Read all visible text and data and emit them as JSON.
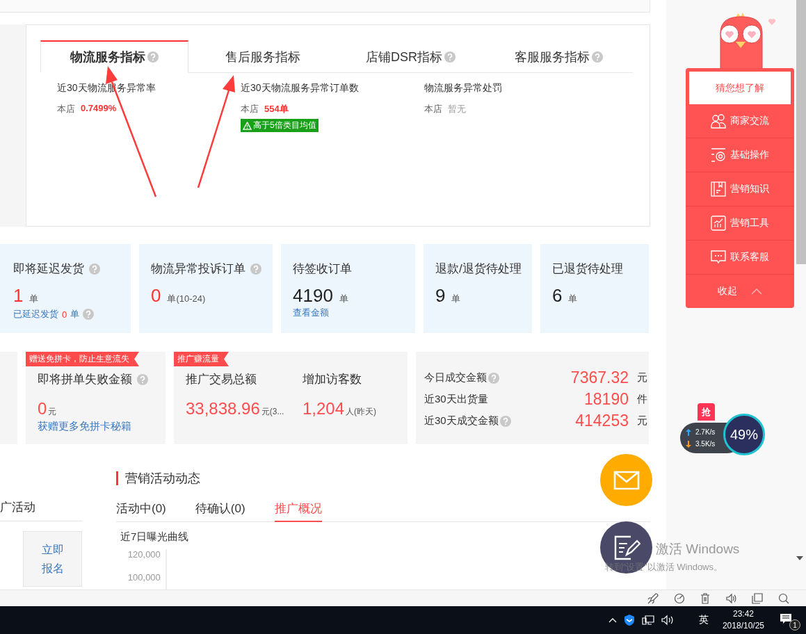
{
  "metric_tabs": [
    {
      "label": "物流服务指标",
      "help": true,
      "selected": true
    },
    {
      "label": "售后服务指标",
      "help": false,
      "selected": false
    },
    {
      "label": "店铺DSR指标",
      "help": true,
      "selected": false
    },
    {
      "label": "客服服务指标",
      "help": true,
      "selected": false
    }
  ],
  "metrics": [
    {
      "title": "近30天物流服务异常率",
      "store_label": "本店",
      "value": "0.7499%",
      "highlighted": true
    },
    {
      "title": "近30天物流服务异常订单数",
      "store_label": "本店",
      "value": "554单",
      "highlighted": true,
      "warning": "高于5倍类目均值"
    },
    {
      "title": "物流服务异常处罚",
      "store_label": "本店",
      "value": "暂无",
      "highlighted": false
    }
  ],
  "order_cards": [
    {
      "title": "即将延迟发货",
      "help": true,
      "count": "1",
      "alert": true,
      "unit": "单",
      "detail": {
        "label": "已延迟发货",
        "count": "0",
        "unit": "单",
        "help": true
      }
    },
    {
      "title": "物流异常投诉订单",
      "help": true,
      "count": "0",
      "alert": true,
      "unit": "单(10-24)"
    },
    {
      "title": "待签收订单",
      "help": false,
      "count": "4190",
      "alert": false,
      "unit": "单",
      "link": "查看金额"
    },
    {
      "title": "退款/退货待处理",
      "help": false,
      "count": "9",
      "alert": false,
      "unit": "单"
    },
    {
      "title": "已退货待处理",
      "help": false,
      "count": "6",
      "alert": false,
      "unit": "单"
    }
  ],
  "group_buy_card": {
    "ribbon": "赠送免拼卡，防止生意流失",
    "title": "即将拼单失败金额",
    "help": true,
    "value": "0",
    "unit": "元",
    "link": "获赠更多免拼卡秘籍"
  },
  "promo_card": {
    "ribbon": "推广赚流量",
    "stats": [
      {
        "label": "推广交易总额",
        "value": "33,838.96",
        "unit": "元(3..."
      },
      {
        "label": "增加访客数",
        "value": "1,204",
        "unit": "人(昨天)"
      }
    ]
  },
  "sales_card": {
    "rows": [
      {
        "label": "今日成交金额",
        "help": true,
        "value": "7367.32",
        "unit": "元"
      },
      {
        "label": "近30天出货量",
        "help": false,
        "value": "18190",
        "unit": "件"
      },
      {
        "label": "近30天成交金额",
        "help": true,
        "value": "414253",
        "unit": "元"
      }
    ]
  },
  "activity_panel": {
    "title": "广活动",
    "action": "立即报名"
  },
  "marketing": {
    "title": "营销活动动态",
    "tabs": [
      {
        "label": "活动中(0)",
        "selected": false
      },
      {
        "label": "待确认(0)",
        "selected": false
      },
      {
        "label": "推广概况",
        "selected": true
      }
    ],
    "chart_title": "近7日曝光曲线",
    "y_tick_labels": [
      "120,000",
      "100,000"
    ]
  },
  "assistant": {
    "header": "猜您想了解",
    "items": [
      {
        "label": "商家交流",
        "kind": "community"
      },
      {
        "label": "基础操作",
        "kind": "operation"
      },
      {
        "label": "营销知识",
        "kind": "knowledge"
      },
      {
        "label": "营销工具",
        "kind": "tools"
      },
      {
        "label": "联系客服",
        "kind": "service"
      }
    ],
    "collapse": "收起"
  },
  "net_widget": {
    "badge": "抢",
    "upload": "2.7K/s",
    "download": "3.5K/s",
    "cpu": "49%"
  },
  "activation_notice": {
    "title": "激活 Windows",
    "hint": "转到“设置”以激活 Windows。"
  },
  "taskbar": {
    "input_method": "英",
    "time": "23:42",
    "date": "2018/10/25",
    "notifications": "1"
  }
}
